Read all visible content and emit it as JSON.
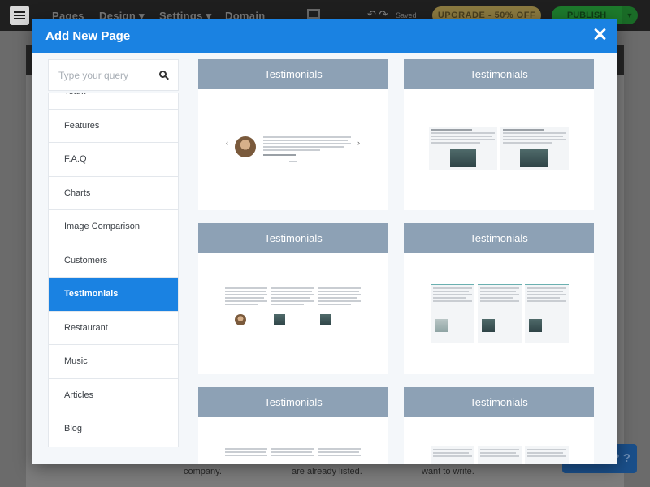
{
  "app": {
    "nav": [
      "Pages",
      "Design ▾",
      "Settings ▾",
      "Domain"
    ],
    "saved_label": "Saved",
    "upgrade_label": "UPGRADE - 50% OFF",
    "publish_label": "PUBLISH",
    "help_label": "? ?",
    "bg_texts": [
      "company.",
      "are already listed.",
      "want to write."
    ]
  },
  "modal": {
    "title": "Add New Page",
    "search_placeholder": "Type your query",
    "categories": [
      {
        "label": "Team",
        "active": false
      },
      {
        "label": "Features",
        "active": false
      },
      {
        "label": "F.A.Q",
        "active": false
      },
      {
        "label": "Charts",
        "active": false
      },
      {
        "label": "Image Comparison",
        "active": false
      },
      {
        "label": "Customers",
        "active": false
      },
      {
        "label": "Testimonials",
        "active": true
      },
      {
        "label": "Restaurant",
        "active": false
      },
      {
        "label": "Music",
        "active": false
      },
      {
        "label": "Articles",
        "active": false
      },
      {
        "label": "Blog",
        "active": false
      }
    ],
    "templates": [
      {
        "title": "Testimonials",
        "variant": "slider"
      },
      {
        "title": "Testimonials",
        "variant": "two-column"
      },
      {
        "title": "Testimonials",
        "variant": "three-column"
      },
      {
        "title": "Testimonials",
        "variant": "three-cards"
      },
      {
        "title": "Testimonials",
        "variant": "three-column"
      },
      {
        "title": "Testimonials",
        "variant": "three-cards"
      }
    ]
  },
  "colors": {
    "header_blue": "#1a82e2",
    "active_blue": "#1a82e2",
    "card_header": "#8da1b5",
    "upgrade": "#8b7a40",
    "publish": "#1d7a2c"
  }
}
